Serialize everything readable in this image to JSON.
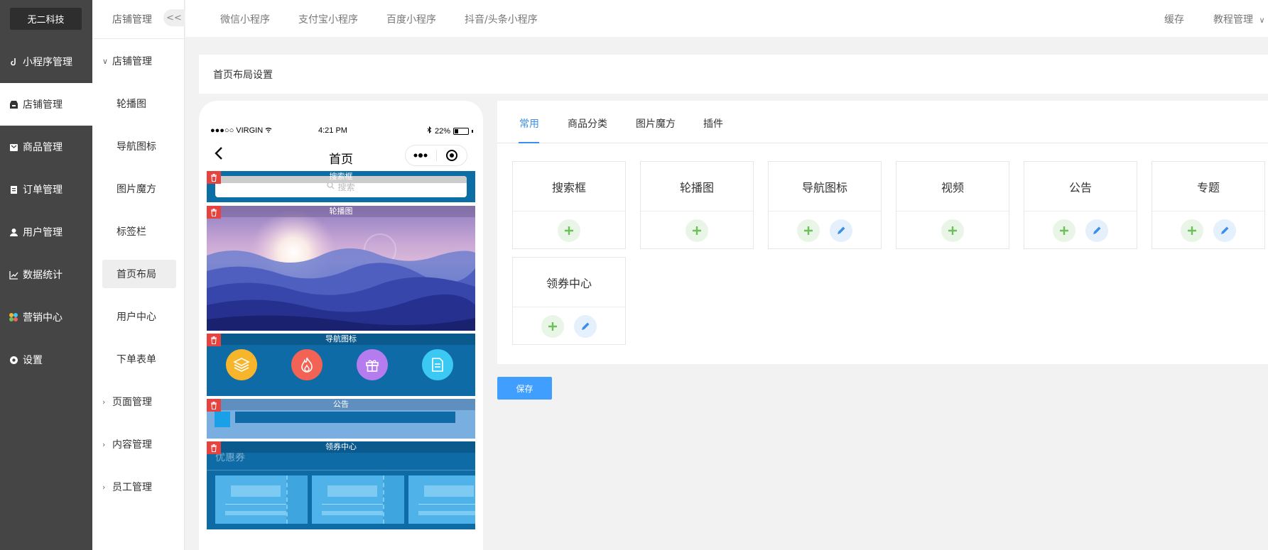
{
  "brand": "无二科技",
  "sidebar": {
    "items": [
      {
        "label": "小程序管理",
        "icon": "link-icon"
      },
      {
        "label": "店铺管理",
        "icon": "shop-icon"
      },
      {
        "label": "商品管理",
        "icon": "box-icon"
      },
      {
        "label": "订单管理",
        "icon": "order-icon"
      },
      {
        "label": "用户管理",
        "icon": "user-icon"
      },
      {
        "label": "数据统计",
        "icon": "chart-icon"
      },
      {
        "label": "营销中心",
        "icon": "marketing-icon"
      },
      {
        "label": "设置",
        "icon": "gear-icon"
      }
    ],
    "active_index": 1
  },
  "submenu": {
    "header": "店铺管理",
    "collapse_label": "<<",
    "group_store": "店铺管理",
    "children": [
      "轮播图",
      "导航图标",
      "图片魔方",
      "标签栏",
      "首页布局",
      "用户中心",
      "下单表单"
    ],
    "active_child": "首页布局",
    "groups": [
      "页面管理",
      "内容管理",
      "员工管理"
    ]
  },
  "topbar": {
    "tabs": [
      "微信小程序",
      "支付宝小程序",
      "百度小程序",
      "抖音/头条小程序"
    ],
    "cache": "缓存",
    "tutorial": "教程管理"
  },
  "content": {
    "title": "首页布局设置"
  },
  "phone": {
    "carrier": "●●●○○ VIRGIN",
    "time": "4:21 PM",
    "battery": "22%",
    "title": "首页",
    "modules": {
      "search": {
        "label": "搜索框",
        "placeholder": "搜索"
      },
      "banner": {
        "label": "轮播图"
      },
      "nav": {
        "label": "导航图标"
      },
      "notice": {
        "label": "公告"
      },
      "coupon": {
        "label": "领券中心",
        "title": "优惠券"
      }
    }
  },
  "panel": {
    "tabs": [
      "常用",
      "商品分类",
      "图片魔方",
      "插件"
    ],
    "active_tab": "常用",
    "components": [
      {
        "name": "搜索框",
        "editable": false
      },
      {
        "name": "轮播图",
        "editable": false
      },
      {
        "name": "导航图标",
        "editable": true
      },
      {
        "name": "视频",
        "editable": false
      },
      {
        "name": "公告",
        "editable": true
      },
      {
        "name": "专题",
        "editable": true
      },
      {
        "name": "领券中心",
        "editable": true
      }
    ]
  },
  "save_label": "保存",
  "colors": {
    "sidebar_bg": "#454545",
    "accent": "#409eff",
    "add_green": "#6cc05a",
    "edit_blue": "#3d8ee8",
    "delete_red": "#e64340",
    "nav_yellow": "#f7b52c",
    "nav_red": "#f26255",
    "nav_purple": "#b57cf0",
    "nav_cyan": "#3bc8f2"
  }
}
